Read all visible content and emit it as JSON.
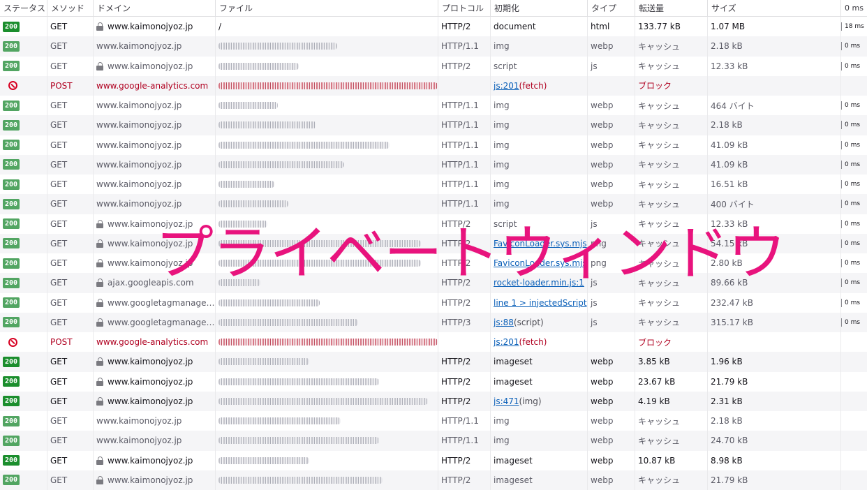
{
  "columns": {
    "status": "ステータス",
    "method": "メソッド",
    "domain": "ドメイン",
    "file": "ファイル",
    "protocol": "プロトコル",
    "initiator": "初期化",
    "type": "タイプ",
    "transferred": "転送量",
    "size": "サイズ",
    "time": "0 ms"
  },
  "watermark": "プライベートウィンドウ",
  "rows": [
    {
      "status": "200",
      "cached": false,
      "method": "GET",
      "lock": true,
      "domain": "www.kaimonojyoz.jp",
      "file": "/",
      "blur": 0,
      "protocol": "HTTP/2",
      "initiator": "document",
      "init_link": "",
      "init_suffix": "",
      "type": "html",
      "transferred": "133.77 kB",
      "size": "1.07 MB",
      "time": "18 ms"
    },
    {
      "status": "200",
      "cached": true,
      "method": "GET",
      "lock": false,
      "domain": "www.kaimonojyoz.jp",
      "file": "",
      "blur": 170,
      "protocol": "HTTP/1.1",
      "initiator": "img",
      "init_link": "",
      "init_suffix": "",
      "type": "webp",
      "transferred": "キャッシュ",
      "size": "2.18 kB",
      "time": "0 ms"
    },
    {
      "status": "200",
      "cached": true,
      "method": "GET",
      "lock": true,
      "domain": "www.kaimonojyoz.jp",
      "file": "",
      "blur": 115,
      "protocol": "HTTP/2",
      "initiator": "script",
      "init_link": "",
      "init_suffix": "",
      "type": "js",
      "transferred": "キャッシュ",
      "size": "12.33 kB",
      "time": "0 ms"
    },
    {
      "status": "blocked",
      "cached": false,
      "method": "POST",
      "lock": false,
      "domain": "www.google-analytics.com",
      "file": "",
      "blur": 315,
      "red": true,
      "protocol": "",
      "initiator": "",
      "init_link": "js:201",
      "init_suffix": " (fetch)",
      "type": "",
      "transferred": "ブロック",
      "size": "",
      "time": ""
    },
    {
      "status": "200",
      "cached": true,
      "method": "GET",
      "lock": false,
      "domain": "www.kaimonojyoz.jp",
      "file": "",
      "blur": 85,
      "protocol": "HTTP/1.1",
      "initiator": "img",
      "init_link": "",
      "init_suffix": "",
      "type": "webp",
      "transferred": "キャッシュ",
      "size": "464 バイト",
      "time": "0 ms"
    },
    {
      "status": "200",
      "cached": true,
      "method": "GET",
      "lock": false,
      "domain": "www.kaimonojyoz.jp",
      "file": "",
      "blur": 140,
      "protocol": "HTTP/1.1",
      "initiator": "img",
      "init_link": "",
      "init_suffix": "",
      "type": "webp",
      "transferred": "キャッシュ",
      "size": "2.18 kB",
      "time": "0 ms"
    },
    {
      "status": "200",
      "cached": true,
      "method": "GET",
      "lock": false,
      "domain": "www.kaimonojyoz.jp",
      "file": "",
      "blur": 245,
      "protocol": "HTTP/1.1",
      "initiator": "img",
      "init_link": "",
      "init_suffix": "",
      "type": "webp",
      "transferred": "キャッシュ",
      "size": "41.09 kB",
      "time": "0 ms"
    },
    {
      "status": "200",
      "cached": true,
      "method": "GET",
      "lock": false,
      "domain": "www.kaimonojyoz.jp",
      "file": "",
      "blur": 180,
      "protocol": "HTTP/1.1",
      "initiator": "img",
      "init_link": "",
      "init_suffix": "",
      "type": "webp",
      "transferred": "キャッシュ",
      "size": "41.09 kB",
      "time": "0 ms"
    },
    {
      "status": "200",
      "cached": true,
      "method": "GET",
      "lock": false,
      "domain": "www.kaimonojyoz.jp",
      "file": "",
      "blur": 80,
      "protocol": "HTTP/1.1",
      "initiator": "img",
      "init_link": "",
      "init_suffix": "",
      "type": "webp",
      "transferred": "キャッシュ",
      "size": "16.51 kB",
      "time": "0 ms"
    },
    {
      "status": "200",
      "cached": true,
      "method": "GET",
      "lock": false,
      "domain": "www.kaimonojyoz.jp",
      "file": "",
      "blur": 100,
      "protocol": "HTTP/1.1",
      "initiator": "img",
      "init_link": "",
      "init_suffix": "",
      "type": "webp",
      "transferred": "キャッシュ",
      "size": "400 バイト",
      "time": "0 ms"
    },
    {
      "status": "200",
      "cached": true,
      "method": "GET",
      "lock": true,
      "domain": "www.kaimonojyoz.jp",
      "file": "",
      "blur": 70,
      "protocol": "HTTP/2",
      "initiator": "script",
      "init_link": "",
      "init_suffix": "",
      "type": "js",
      "transferred": "キャッシュ",
      "size": "12.33 kB",
      "time": "0 ms"
    },
    {
      "status": "200",
      "cached": true,
      "method": "GET",
      "lock": true,
      "domain": "www.kaimonojyoz.jp",
      "file": "",
      "blur": 290,
      "protocol": "HTTP/2",
      "initiator": "",
      "init_link": "FaviconLoader.sys.mjs",
      "init_suffix": "",
      "type": "png",
      "transferred": "キャッシュ",
      "size": "54.15 kB",
      "time": "0 ms"
    },
    {
      "status": "200",
      "cached": true,
      "method": "GET",
      "lock": true,
      "domain": "www.kaimonojyoz.jp",
      "file": "",
      "blur": 290,
      "protocol": "HTTP/2",
      "initiator": "",
      "init_link": "FaviconLoader.sys.mjs",
      "init_suffix": "",
      "type": "png",
      "transferred": "キャッシュ",
      "size": "2.80 kB",
      "time": "0 ms"
    },
    {
      "status": "200",
      "cached": true,
      "method": "GET",
      "lock": true,
      "domain": "ajax.googleapis.com",
      "file": "",
      "blur": 60,
      "protocol": "HTTP/2",
      "initiator": "",
      "init_link": "rocket-loader.min.js:1",
      "init_suffix": "",
      "type": "js",
      "transferred": "キャッシュ",
      "size": "89.66 kB",
      "time": "0 ms"
    },
    {
      "status": "200",
      "cached": true,
      "method": "GET",
      "lock": true,
      "domain": "www.googletagmanager.com",
      "file": "",
      "blur": 145,
      "protocol": "HTTP/2",
      "initiator": "",
      "init_link": "line 1 > injectedScript",
      "init_suffix": "",
      "type": "js",
      "transferred": "キャッシュ",
      "size": "232.47 kB",
      "time": "0 ms"
    },
    {
      "status": "200",
      "cached": true,
      "method": "GET",
      "lock": true,
      "domain": "www.googletagmanager.com",
      "file": "",
      "blur": 200,
      "protocol": "HTTP/3",
      "initiator": "",
      "init_link": "js:88",
      "init_suffix": " (script)",
      "type": "js",
      "transferred": "キャッシュ",
      "size": "315.17 kB",
      "time": "0 ms"
    },
    {
      "status": "blocked",
      "cached": false,
      "method": "POST",
      "lock": false,
      "domain": "www.google-analytics.com",
      "file": "",
      "blur": 315,
      "red": true,
      "protocol": "",
      "initiator": "",
      "init_link": "js:201",
      "init_suffix": " (fetch)",
      "type": "",
      "transferred": "ブロック",
      "size": "",
      "time": ""
    },
    {
      "status": "200",
      "cached": false,
      "method": "GET",
      "lock": true,
      "domain": "www.kaimonojyoz.jp",
      "file": "",
      "blur": 130,
      "protocol": "HTTP/2",
      "initiator": "imageset",
      "init_link": "",
      "init_suffix": "",
      "type": "webp",
      "transferred": "3.85 kB",
      "size": "1.96 kB",
      "time": ""
    },
    {
      "status": "200",
      "cached": false,
      "method": "GET",
      "lock": true,
      "domain": "www.kaimonojyoz.jp",
      "file": "",
      "blur": 230,
      "protocol": "HTTP/2",
      "initiator": "imageset",
      "init_link": "",
      "init_suffix": "",
      "type": "webp",
      "transferred": "23.67 kB",
      "size": "21.79 kB",
      "time": ""
    },
    {
      "status": "200",
      "cached": false,
      "method": "GET",
      "lock": true,
      "domain": "www.kaimonojyoz.jp",
      "file": "",
      "blur": 300,
      "protocol": "HTTP/2",
      "initiator": "",
      "init_link": "js:471",
      "init_suffix": " (img)",
      "type": "webp",
      "transferred": "4.19 kB",
      "size": "2.31 kB",
      "time": ""
    },
    {
      "status": "200",
      "cached": true,
      "method": "GET",
      "lock": false,
      "domain": "www.kaimonojyoz.jp",
      "file": "",
      "blur": 175,
      "protocol": "HTTP/1.1",
      "initiator": "img",
      "init_link": "",
      "init_suffix": "",
      "type": "webp",
      "transferred": "キャッシュ",
      "size": "2.18 kB",
      "time": ""
    },
    {
      "status": "200",
      "cached": true,
      "method": "GET",
      "lock": false,
      "domain": "www.kaimonojyoz.jp",
      "file": "",
      "blur": 230,
      "protocol": "HTTP/1.1",
      "initiator": "img",
      "init_link": "",
      "init_suffix": "",
      "type": "webp",
      "transferred": "キャッシュ",
      "size": "24.70 kB",
      "time": ""
    },
    {
      "status": "200",
      "cached": false,
      "method": "GET",
      "lock": true,
      "domain": "www.kaimonojyoz.jp",
      "file": "",
      "blur": 130,
      "protocol": "HTTP/2",
      "initiator": "imageset",
      "init_link": "",
      "init_suffix": "",
      "type": "webp",
      "transferred": "10.87 kB",
      "size": "8.98 kB",
      "time": ""
    },
    {
      "status": "200",
      "cached": true,
      "method": "GET",
      "lock": true,
      "domain": "www.kaimonojyoz.jp",
      "file": "",
      "blur": 235,
      "protocol": "HTTP/2",
      "initiator": "imageset",
      "init_link": "",
      "init_suffix": "",
      "type": "webp",
      "transferred": "キャッシュ",
      "size": "21.79 kB",
      "time": ""
    }
  ]
}
